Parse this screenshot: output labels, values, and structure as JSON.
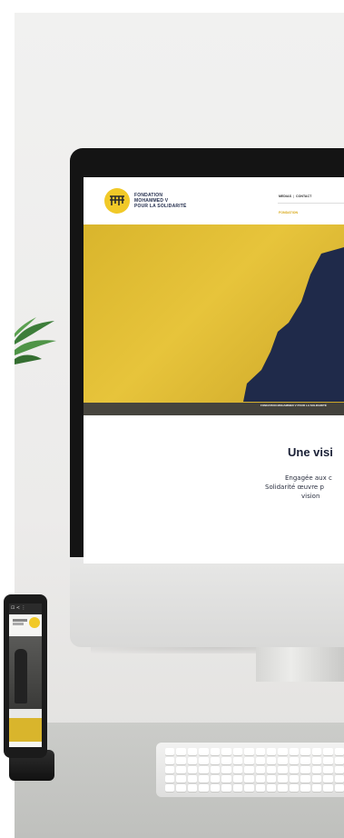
{
  "site": {
    "logo_lines": [
      "FONDATION",
      "MOHAMMED V",
      "POUR LA SOLIDARITÉ"
    ],
    "nav": {
      "media": "MEDIAS",
      "contact": "CONTACT",
      "active": "FONDATION"
    },
    "hero_caption": "FONDATION MOHAMMED V POUR LA SOLIDARITÉ",
    "headline": "Une visi",
    "body": [
      "Engagée aux c",
      "Solidarité œuvre p",
      "vision"
    ]
  },
  "colors": {
    "accent_yellow": "#e0bc33",
    "navy": "#1f2a4a"
  },
  "icons": {
    "phone_status": "⊡ ≺ ⋮"
  }
}
